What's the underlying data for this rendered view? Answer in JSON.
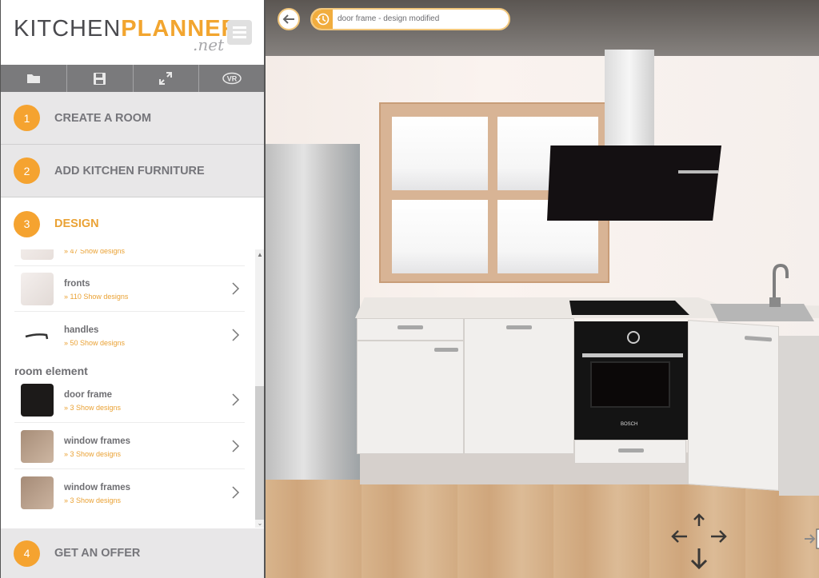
{
  "app": {
    "logo_part1": "KITCHEN",
    "logo_part2": "PLANNER",
    "logo_suffix": ".net",
    "brand_color": "#f5a330",
    "menu_icon": "hamburger-icon"
  },
  "toolbar": {
    "buttons": [
      {
        "name": "open",
        "icon": "folder-icon"
      },
      {
        "name": "save",
        "icon": "floppy-disk-icon"
      },
      {
        "name": "fullscreen",
        "icon": "expand-icon"
      },
      {
        "name": "vr",
        "icon": "vr-icon",
        "label": "VR"
      }
    ]
  },
  "steps": [
    {
      "number": "1",
      "label": "CREATE A ROOM",
      "active": false
    },
    {
      "number": "2",
      "label": "ADD KITCHEN FURNITURE",
      "active": false
    },
    {
      "number": "3",
      "label": "DESIGN",
      "active": true
    },
    {
      "number": "4",
      "label": "GET AN OFFER",
      "active": false
    }
  ],
  "design": {
    "items": [
      {
        "title": "",
        "sub": "» 47 Show designs"
      },
      {
        "title": "fronts",
        "sub": "» 110 Show designs"
      },
      {
        "title": "handles",
        "sub": "» 50 Show designs"
      }
    ],
    "section_room": "room element",
    "room_items": [
      {
        "title": "door frame",
        "sub": "» 3 Show designs",
        "swatch": "#1c1a19"
      },
      {
        "title": "window frames",
        "sub": "» 3 Show designs",
        "swatch": "#b89c86"
      },
      {
        "title": "window frames",
        "sub": "» 3 Show designs",
        "swatch": "#b59a85"
      }
    ]
  },
  "viewport": {
    "status_text": "door frame - design modified",
    "status_icon": "history-icon",
    "back_icon": "arrow-left-icon",
    "oven_brand": "BOSCH",
    "pan_controls": [
      "up",
      "down",
      "left",
      "right"
    ],
    "zoom_controls": [
      "zoom-in",
      "zoom-out"
    ]
  }
}
